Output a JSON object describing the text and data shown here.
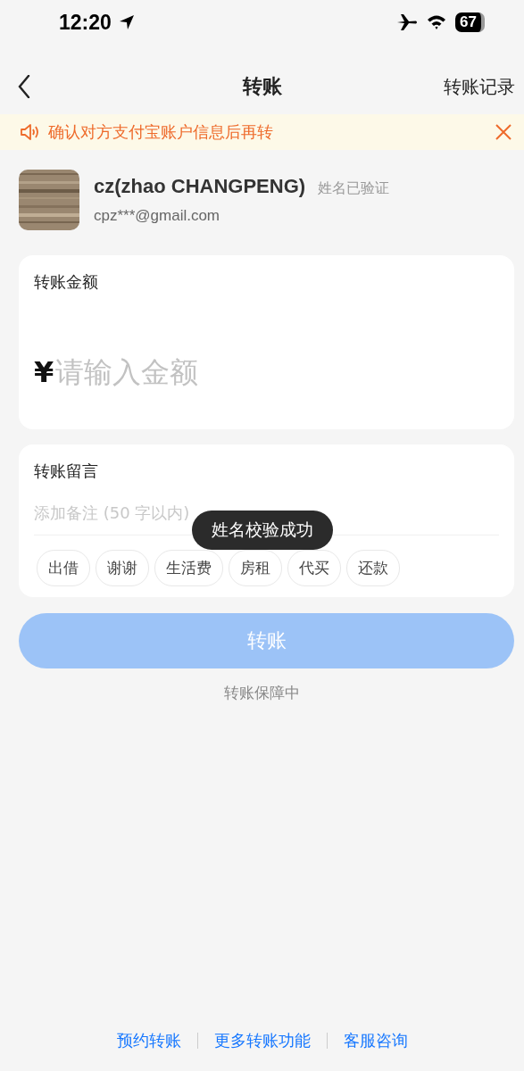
{
  "status_bar": {
    "time": "12:20",
    "battery": "67"
  },
  "nav": {
    "title": "转账",
    "action": "转账记录"
  },
  "notice": {
    "text": "确认对方支付宝账户信息后再转"
  },
  "recipient": {
    "name": "cz(zhao CHANGPENG)",
    "badge": "姓名已验证",
    "account": "cpz***@gmail.com"
  },
  "amount": {
    "label": "转账金额",
    "currency": "¥",
    "placeholder": "请输入金额"
  },
  "message": {
    "label": "转账留言",
    "placeholder": "添加备注 (50 字以内)",
    "chips": [
      "出借",
      "谢谢",
      "生活费",
      "房租",
      "代买",
      "还款"
    ]
  },
  "submit": {
    "label": "转账",
    "disabled": true
  },
  "guarantee": "转账保障中",
  "toast": "姓名校验成功",
  "footer_links": [
    "预约转账",
    "更多转账功能",
    "客服咨询"
  ]
}
